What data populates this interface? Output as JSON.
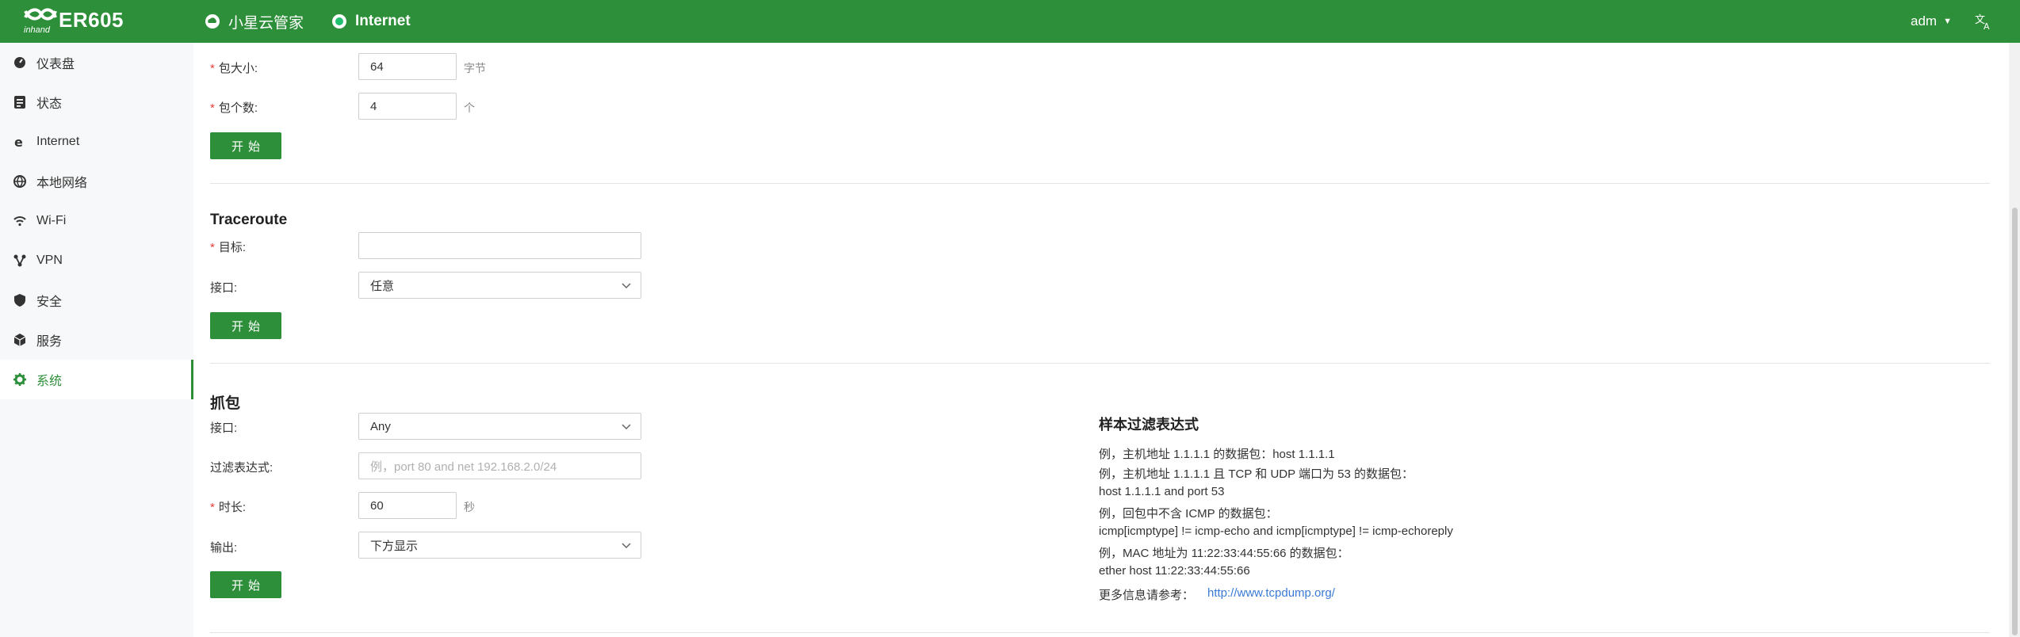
{
  "header": {
    "logo_text": "ER605",
    "logo_sub": "inhand",
    "nav": [
      {
        "label": "小星云管家"
      },
      {
        "label": "Internet"
      }
    ],
    "user": "adm"
  },
  "sidebar": {
    "items": [
      {
        "label": "仪表盘",
        "icon": "dashboard-icon"
      },
      {
        "label": "状态",
        "icon": "status-icon"
      },
      {
        "label": "Internet",
        "icon": "internet-icon"
      },
      {
        "label": "本地网络",
        "icon": "globe-icon"
      },
      {
        "label": "Wi-Fi",
        "icon": "wifi-icon"
      },
      {
        "label": "VPN",
        "icon": "vpn-icon"
      },
      {
        "label": "安全",
        "icon": "shield-icon"
      },
      {
        "label": "服务",
        "icon": "cube-icon"
      },
      {
        "label": "系统",
        "icon": "gear-icon",
        "active": true
      }
    ]
  },
  "ping": {
    "packet_size_label": "包大小:",
    "packet_size_value": "64",
    "packet_size_unit": "字节",
    "packet_count_label": "包个数:",
    "packet_count_value": "4",
    "packet_count_unit": "个",
    "start_label": "开始"
  },
  "traceroute": {
    "title": "Traceroute",
    "target_label": "目标:",
    "target_value": "",
    "interface_label": "接口:",
    "interface_value": "任意",
    "start_label": "开始"
  },
  "capture": {
    "title": "抓包",
    "interface_label": "接口:",
    "interface_value": "Any",
    "filter_label": "过滤表达式:",
    "filter_placeholder": "例，port 80 and net 192.168.2.0/24",
    "duration_label": "时长:",
    "duration_value": "60",
    "duration_unit": "秒",
    "output_label": "输出:",
    "output_value": "下方显示",
    "start_label": "开始"
  },
  "samples": {
    "title": "样本过滤表达式",
    "lines": [
      "例，主机地址 1.1.1.1 的数据包：host 1.1.1.1",
      "例，主机地址 1.1.1.1 且 TCP 和 UDP 端口为 53 的数据包：",
      "host 1.1.1.1 and port 53",
      "例，回包中不含 ICMP 的数据包：",
      "icmp[icmptype] != icmp-echo and icmp[icmptype] != icmp-echoreply",
      "例，MAC 地址为 11:22:33:44:55:66 的数据包：",
      "ether host 11:22:33:44:55:66"
    ],
    "ref_label": "更多信息请参考：",
    "ref_link": "http://www.tcpdump.org/"
  },
  "colors": {
    "brand": "#2e8f3a",
    "required": "#e0403a",
    "link": "#3a7bd5"
  }
}
